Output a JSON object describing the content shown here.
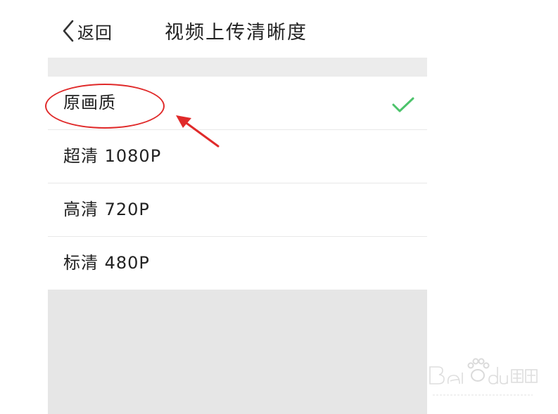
{
  "header": {
    "back_label": "返回",
    "title": "视频上传清晰度"
  },
  "options": [
    {
      "label": "原画质",
      "selected": true
    },
    {
      "label": "超清 1080P",
      "selected": false
    },
    {
      "label": "高清 720P",
      "selected": false
    },
    {
      "label": "标清 480P",
      "selected": false
    }
  ],
  "colors": {
    "check": "#4cc36b",
    "annotation": "#e02a2a",
    "band": "#ececec"
  },
  "icons": {
    "back": "chevron-left-icon",
    "selected": "check-icon"
  },
  "watermark": {
    "brand": "Baidu经验",
    "url": "jingyan.baidu.com"
  }
}
